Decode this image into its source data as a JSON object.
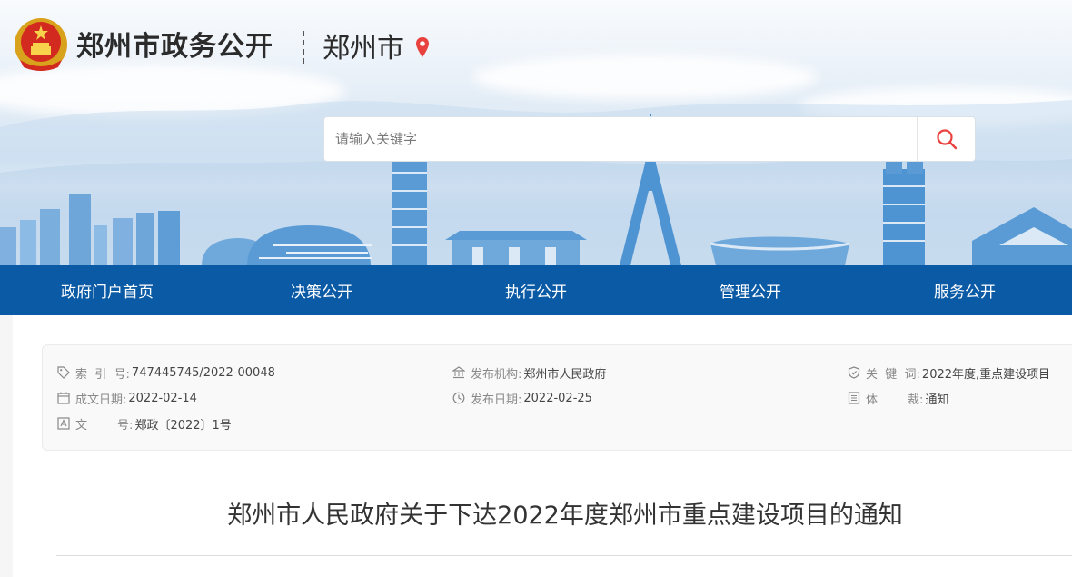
{
  "header": {
    "site_title": "郑州市政务公开",
    "city": "郑州市",
    "emblem_icon": "national-emblem-icon",
    "location_icon": "location-pin-icon",
    "accent_color": "#e8413e"
  },
  "search": {
    "placeholder": "请输入关键字",
    "value": "",
    "button_icon": "search-icon"
  },
  "nav": {
    "color": "#0a5aa5",
    "items": [
      {
        "label": "政府门户首页"
      },
      {
        "label": "决策公开"
      },
      {
        "label": "执行公开"
      },
      {
        "label": "管理公开"
      },
      {
        "label": "服务公开"
      }
    ]
  },
  "meta": {
    "index_no": {
      "label": "索  引  号:",
      "value": "747445745/2022-00048",
      "icon": "tag-icon"
    },
    "date_written": {
      "label": "成文日期:",
      "value": "2022-02-14",
      "icon": "calendar-icon"
    },
    "doc_no": {
      "label": "文        号:",
      "value": "郑政〔2022〕1号",
      "icon": "document-icon"
    },
    "issuer": {
      "label": "发布机构:",
      "value": "郑州市人民政府",
      "icon": "building-icon"
    },
    "date_published": {
      "label": "发布日期:",
      "value": "2022-02-25",
      "icon": "clock-icon"
    },
    "keywords": {
      "label": "关  键  词:",
      "value": "2022年度,重点建设项目",
      "icon": "shield-icon"
    },
    "genre": {
      "label": "体        裁:",
      "value": "通知",
      "icon": "list-icon"
    }
  },
  "document": {
    "title": "郑州市人民政府关于下达2022年度郑州市重点建设项目的通知"
  }
}
